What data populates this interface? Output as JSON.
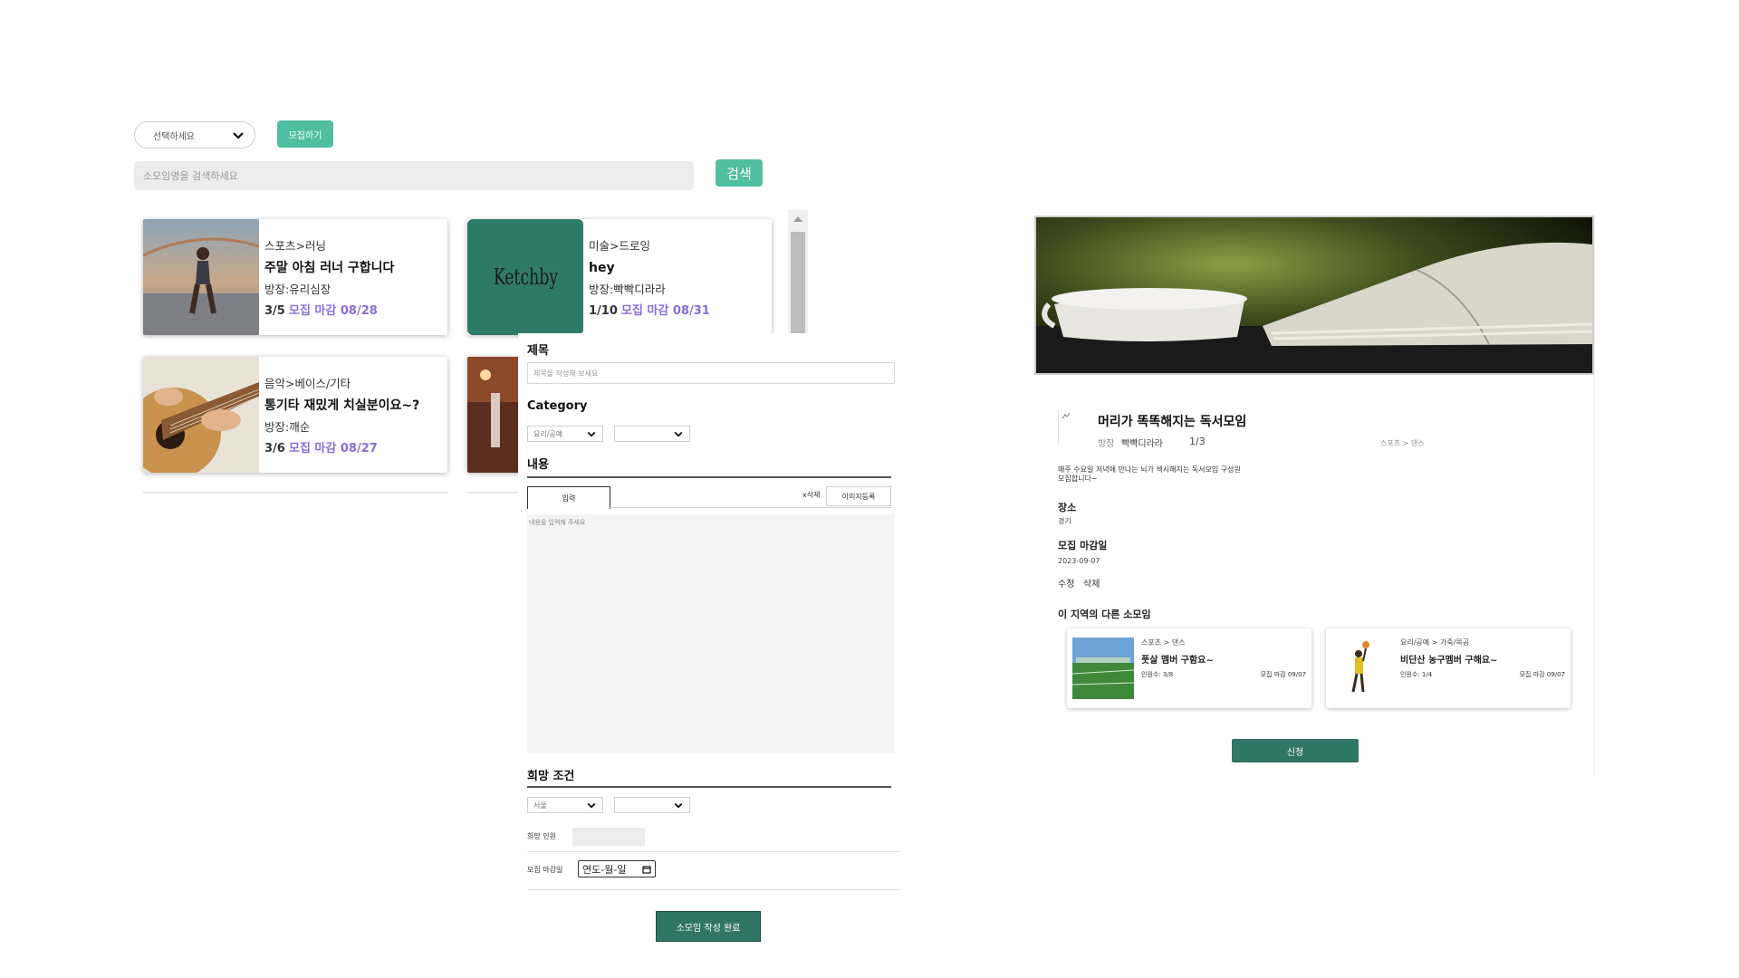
{
  "list_page": {
    "select_placeholder": "선택하세요",
    "recruit_button": "모집하기",
    "search_placeholder": "소모임명을 검색하세요",
    "search_button": "검색",
    "cards": [
      {
        "category": "스포츠>러닝",
        "title": "주말 아침 러너 구합니다",
        "host": "방장:유리심장",
        "count": "3/5",
        "deadline": "모집 마감 08/28"
      },
      {
        "category": "미술>드로잉",
        "title": "hey",
        "host": "방장:빡빡디라라",
        "count": "1/10",
        "deadline": "모집 마감 08/31",
        "logo_text": "Ketchby"
      },
      {
        "category": "음악>베이스/기타",
        "title": "통기타 재밌게 치실분이요~?",
        "host": "방장:깨순",
        "count": "3/6",
        "deadline": "모집 마감 08/27"
      }
    ]
  },
  "form": {
    "title_label": "제목",
    "title_placeholder": "제목을 작성해 보세요",
    "category_label": "Category",
    "category_select_1": "요리/공예",
    "category_select_2": "",
    "content_label": "내용",
    "tab_input": "입력",
    "delete_label": "x삭제",
    "image_button": "이미지등록",
    "content_placeholder": "내용을 입력해 주세요",
    "conditions_label": "희망 조건",
    "region_select_1": "서울",
    "region_select_2": "",
    "members_label": "희망 인원",
    "deadline_label": "모집 마감일",
    "deadline_placeholder": "연도-월-일",
    "submit_button": "소모임 작성 완료"
  },
  "detail": {
    "group_title": "머리가 똑똑해지는 독서모임",
    "host_label": "방장",
    "host_name": "빡빡디라라",
    "count": "1/3",
    "category": "스포츠 > 댄스",
    "description_1": "매주 수요일 저녁에 만나는 뇌가 섹시해지는 독서모임 구성원",
    "description_2": "모집합니다~",
    "place_label": "장소",
    "place_value": "경기",
    "deadline_label": "모집 마감일",
    "deadline_value": "2023-09-07",
    "edit_label": "수정",
    "delete_label": "삭제",
    "other_groups_label": "이 지역의 다른 소모임",
    "other_groups": [
      {
        "category": "스포츠 > 댄스",
        "title": "풋살 멤버 구함요~",
        "members": "인원수: 3/8",
        "deadline": "모집 마감 09/07"
      },
      {
        "category": "요리/공예 > 가죽/목공",
        "title": "비단산 농구멤버 구해요~",
        "members": "인원수: 1/4",
        "deadline": "모집 마감 09/07"
      }
    ],
    "apply_button": "신청"
  },
  "colors": {
    "accent": "#4fbfa0",
    "dark_green": "#2f7664",
    "deadline_purple": "#8a6be0",
    "ketchby_teal": "#2e7a68"
  }
}
